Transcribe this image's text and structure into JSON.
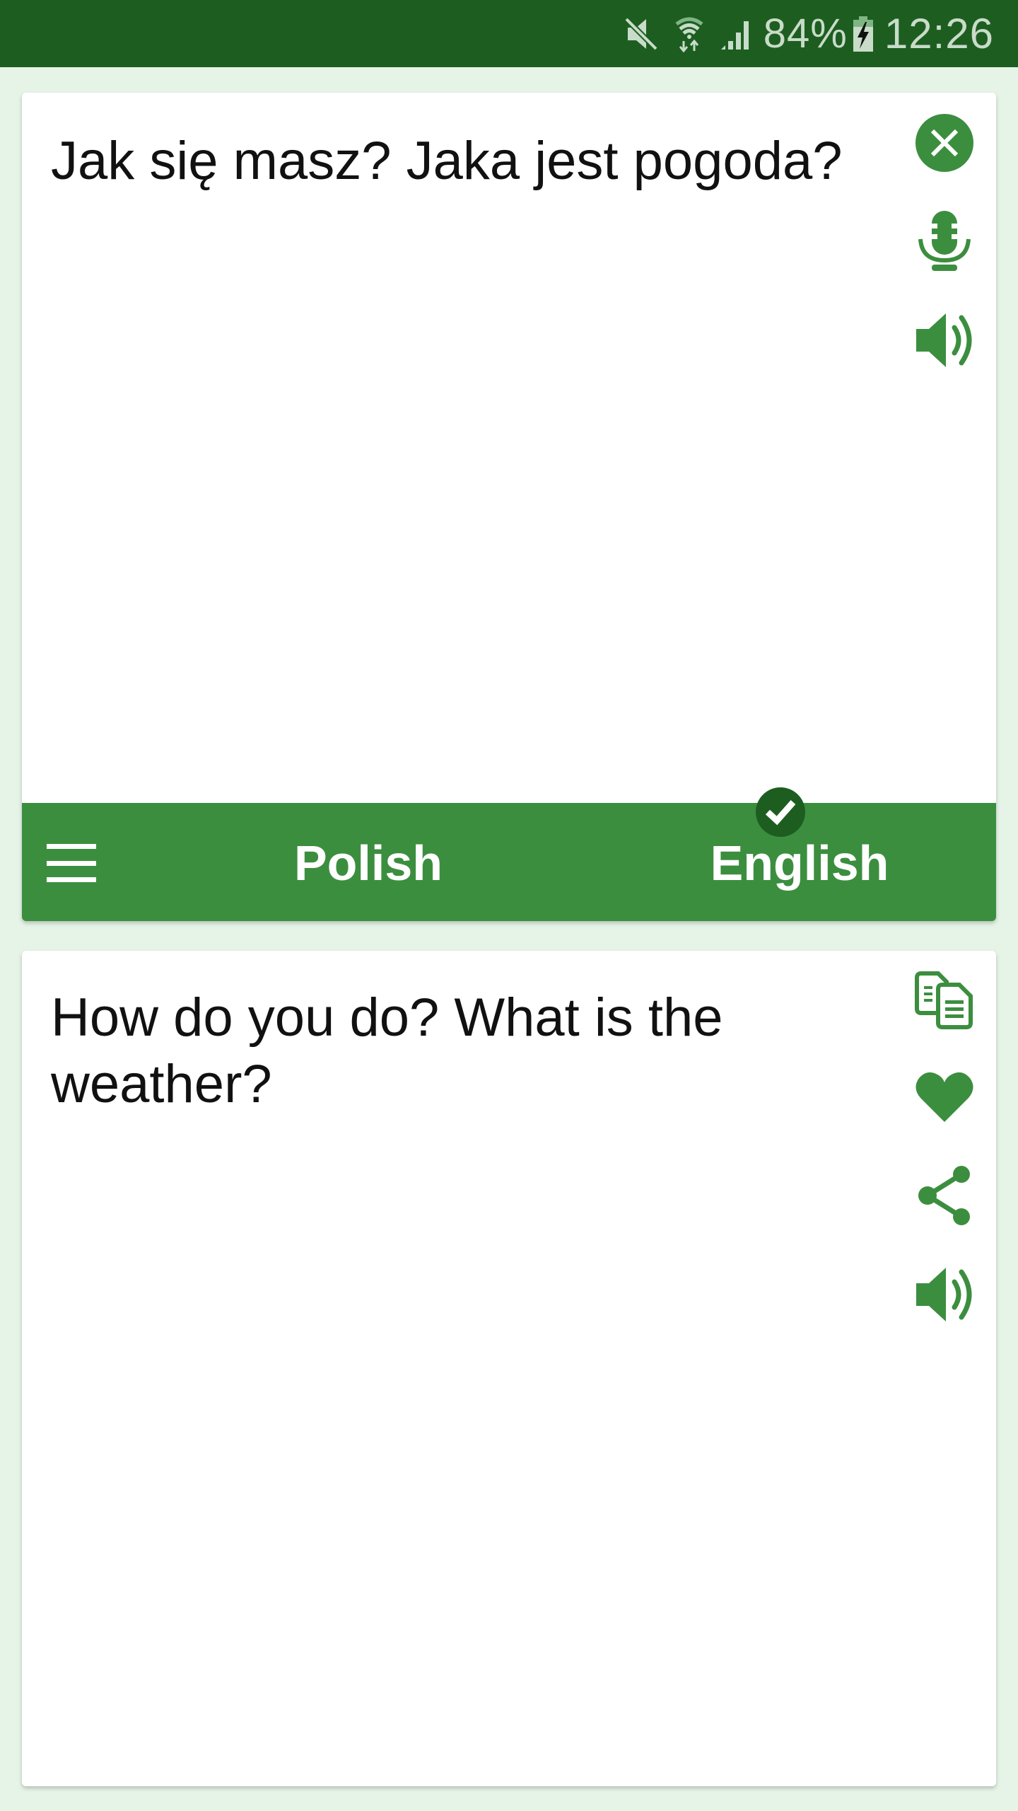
{
  "status_bar": {
    "icons": [
      "mute-icon",
      "wifi-icon",
      "signal-icon",
      "battery-charging-icon"
    ],
    "battery_percent": "84%",
    "time": "12:26"
  },
  "source_panel": {
    "text": "Jak się masz? Jaka jest pogoda?",
    "actions": [
      {
        "name": "clear",
        "icon": "close-circle-icon"
      },
      {
        "name": "voice-input",
        "icon": "microphone-icon"
      },
      {
        "name": "speak",
        "icon": "speaker-icon"
      }
    ]
  },
  "language_bar": {
    "menu_icon": "hamburger-menu-icon",
    "source_language": "Polish",
    "target_language": "English",
    "selected_indicator_icon": "checkmark-icon"
  },
  "target_panel": {
    "text": "How do you do? What is the weather?",
    "actions": [
      {
        "name": "copy",
        "icon": "copy-icon"
      },
      {
        "name": "favorite",
        "icon": "heart-icon"
      },
      {
        "name": "share",
        "icon": "share-icon"
      },
      {
        "name": "speak",
        "icon": "speaker-icon"
      }
    ]
  },
  "colors": {
    "status_bar": "#1d5e20",
    "accent": "#3c8e3f",
    "background": "#e6f4e8",
    "card": "#ffffff",
    "text": "#111111"
  }
}
